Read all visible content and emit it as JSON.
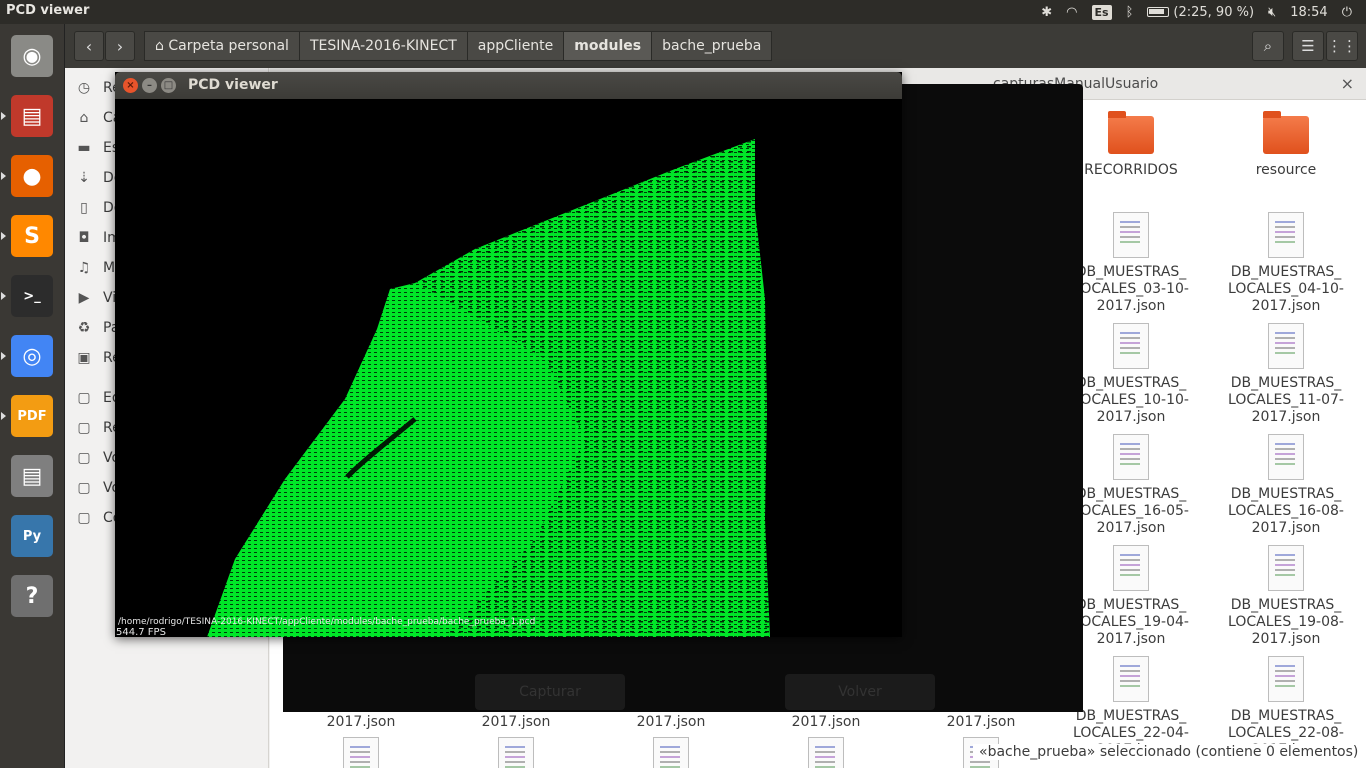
{
  "top_panel": {
    "app_title": "PCD viewer",
    "keyboard": "Es",
    "battery": "(2:25, 90 %)",
    "clock": "18:54"
  },
  "launcher": {
    "items": [
      {
        "name": "dash",
        "glyph": "◉",
        "color": "#8a8a86"
      },
      {
        "name": "files",
        "glyph": "▤",
        "color": "#c0392b"
      },
      {
        "name": "firefox",
        "glyph": "●",
        "color": "#e66000"
      },
      {
        "name": "sublime-text",
        "glyph": "S",
        "color": "#ff8800"
      },
      {
        "name": "terminal",
        "glyph": ">_",
        "color": "#2c2c2c"
      },
      {
        "name": "chrome",
        "glyph": "◎",
        "color": "#4285f4"
      },
      {
        "name": "foxit-pdf",
        "glyph": "PDF",
        "color": "#f39c12"
      },
      {
        "name": "files-2",
        "glyph": "▤",
        "color": "#7f7f7f"
      },
      {
        "name": "python",
        "glyph": "Py",
        "color": "#3776ab"
      },
      {
        "name": "help",
        "glyph": "?",
        "color": "#6f6f6f"
      }
    ]
  },
  "file_manager": {
    "breadcrumbs": [
      {
        "label": "Carpeta personal",
        "active": false
      },
      {
        "label": "TESINA-2016-KINECT",
        "active": false
      },
      {
        "label": "appCliente",
        "active": false
      },
      {
        "label": "modules",
        "active": true
      },
      {
        "label": "bache_prueba",
        "active": false
      }
    ],
    "sidebar": [
      {
        "label": "Re",
        "icon": "◷"
      },
      {
        "label": "Ca",
        "icon": "⌂"
      },
      {
        "label": "Es",
        "icon": "▬"
      },
      {
        "label": "De",
        "icon": "⇣"
      },
      {
        "label": "Do",
        "icon": "▯"
      },
      {
        "label": "Im",
        "icon": "◘"
      },
      {
        "label": "M",
        "icon": "♫"
      },
      {
        "label": "Vi",
        "icon": "▶"
      },
      {
        "label": "Pa",
        "icon": "♻"
      },
      {
        "label": "Re",
        "icon": "▣"
      },
      {
        "label": "Ed",
        "icon": "▢"
      },
      {
        "label": "Re",
        "icon": "▢"
      },
      {
        "label": "Vo",
        "icon": "▢"
      },
      {
        "label": "Vo",
        "icon": "▢"
      },
      {
        "label": "Co",
        "icon": "▢"
      }
    ],
    "tab_title": "capturasManualUsuario",
    "files_right": [
      {
        "label": "RECORRIDOS",
        "kind": "folder"
      },
      {
        "label": "resource",
        "kind": "folder"
      },
      {
        "label": "DB_MUESTRAS_ LOCALES_03-10- 2017.json",
        "kind": "doc"
      },
      {
        "label": "DB_MUESTRAS_ LOCALES_04-10- 2017.json",
        "kind": "doc"
      },
      {
        "label": "DB_MUESTRAS_ LOCALES_10-10- 2017.json",
        "kind": "doc"
      },
      {
        "label": "DB_MUESTRAS_ LOCALES_11-07- 2017.json",
        "kind": "doc"
      },
      {
        "label": "DB_MUESTRAS_ LOCALES_16-05- 2017.json",
        "kind": "doc"
      },
      {
        "label": "DB_MUESTRAS_ LOCALES_16-08- 2017.json",
        "kind": "doc"
      },
      {
        "label": "DB_MUESTRAS_ LOCALES_19-04- 2017.json",
        "kind": "doc"
      },
      {
        "label": "DB_MUESTRAS_ LOCALES_19-08- 2017.json",
        "kind": "doc"
      },
      {
        "label": "DB_MUESTRAS_ LOCALES_22-04- 2017.json",
        "kind": "doc"
      },
      {
        "label": "DB_MUESTRAS_ LOCALES_22-08- 2017.json",
        "kind": "doc"
      }
    ],
    "files_bottom": [
      "2017.json",
      "2017.json",
      "2017.json",
      "2017.json",
      "2017.json"
    ],
    "status": "«bache_prueba» seleccionado  (contiene 0 elementos)"
  },
  "background_window": {
    "capture_label": "Capturar",
    "back_label": "Volver"
  },
  "pcd_viewer": {
    "title": "PCD viewer",
    "file_path": "/home/rodrigo/TESINA-2016-KINECT/appCliente/modules/bache_prueba/bache_prueba_1.pcd",
    "fps": "544.7 FPS",
    "point_color": "#00ee22"
  }
}
